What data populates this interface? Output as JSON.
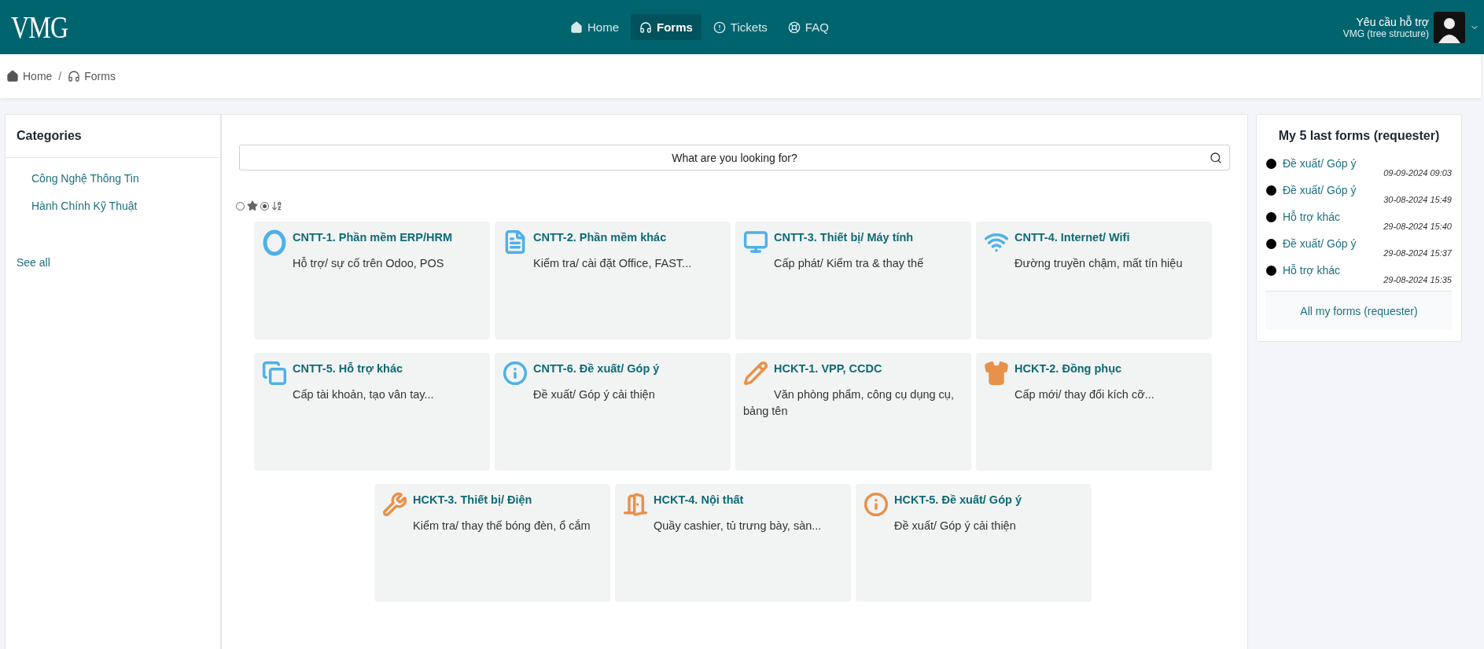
{
  "header": {
    "logo": "VMG",
    "nav": [
      {
        "label": "Home",
        "kind": "home",
        "selected": false
      },
      {
        "label": "Forms",
        "kind": "headset",
        "selected": true
      },
      {
        "label": "Tickets",
        "kind": "alert",
        "selected": false
      },
      {
        "label": "FAQ",
        "kind": "lifebuoy",
        "selected": false
      }
    ],
    "user": {
      "name": "Yêu cầu hỗ trợ",
      "entity": "VMG (tree structure)"
    }
  },
  "breadcrumb": {
    "separator": "/",
    "items": [
      {
        "label": "Home",
        "kind": "home"
      },
      {
        "label": "Forms",
        "kind": "headset"
      }
    ]
  },
  "categories": {
    "title": "Categories",
    "items": [
      "Công Nghệ Thông Tin",
      "Hành Chính Kỹ Thuật"
    ],
    "see_all": "See all"
  },
  "search": {
    "placeholder": "What are you looking for?"
  },
  "sort_options": [
    {
      "kind": "star",
      "selected": false
    },
    {
      "kind": "sort",
      "selected": true
    }
  ],
  "form_rows": [
    [
      {
        "title": "CNTT-1. Phần mềm ERP/HRM",
        "description": "Hỗ trợ/ sự cố trên Odoo, POS",
        "kind": "ring",
        "color": "#4fb0e8"
      },
      {
        "title": "CNTT-2. Phần mềm khác",
        "description": "Kiểm tra/ cài đặt Office, FAST...",
        "kind": "document",
        "color": "#4fb0e8"
      },
      {
        "title": "CNTT-3. Thiết bị/ Máy tính",
        "description": "Cấp phát/ Kiểm tra & thay thế",
        "kind": "monitor",
        "color": "#4fb0e8"
      },
      {
        "title": "CNTT-4. Internet/ Wifi",
        "description": "Đường truyền chậm, mất tín hiệu",
        "kind": "wifi",
        "color": "#4fb0e8"
      }
    ],
    [
      {
        "title": "CNTT-5. Hỗ trợ khác",
        "description": "Cấp tài khoản, tạo vân tay...",
        "kind": "copy",
        "color": "#4fb0e8"
      },
      {
        "title": "CNTT-6. Đề xuất/ Góp ý",
        "description": "Đề xuất/ Góp ý cải thiện",
        "kind": "info",
        "color": "#4fb0e8"
      },
      {
        "title": "HCKT-1. VPP, CCDC",
        "description": "Văn phòng phẩm, công cụ dụng cụ, bảng tên",
        "kind": "pencil",
        "color": "#e8914a"
      },
      {
        "title": "HCKT-2. Đồng phục",
        "description": "Cấp mới/ thay đổi kích cỡ...",
        "kind": "shirt",
        "color": "#e8914a"
      }
    ],
    [
      {
        "title": "HCKT-3. Thiết bị/ Điện",
        "description": "Kiểm tra/ thay thế bóng đèn, ổ cắm",
        "kind": "tools",
        "color": "#e8914a"
      },
      {
        "title": "HCKT-4. Nội thất",
        "description": "Quầy cashier, tủ trưng bày, sàn...",
        "kind": "door",
        "color": "#e8914a"
      },
      {
        "title": "HCKT-5. Đề xuất/ Góp ý",
        "description": "Đề xuất/ Góp ý cải thiện",
        "kind": "info",
        "color": "#e8914a"
      }
    ]
  ],
  "last_forms": {
    "title": "My 5 last forms (requester)",
    "items": [
      {
        "name": "Đề xuất/ Góp ý",
        "date": "09-09-2024 09:03"
      },
      {
        "name": "Đề xuất/ Góp ý",
        "date": "30-08-2024 15:49"
      },
      {
        "name": "Hỗ trợ khác",
        "date": "29-08-2024 15:40"
      },
      {
        "name": "Đề xuất/ Góp ý",
        "date": "29-08-2024 15:37"
      },
      {
        "name": "Hỗ trợ khác",
        "date": "29-08-2024 15:35"
      }
    ],
    "all_link": "All my forms (requester)"
  }
}
